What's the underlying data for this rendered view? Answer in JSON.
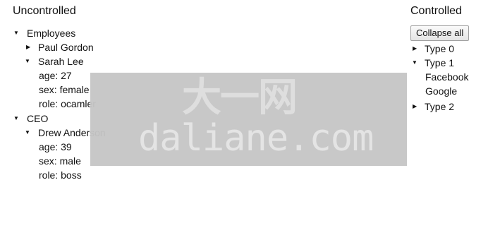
{
  "uncontrolled": {
    "title": "Uncontrolled",
    "employees": {
      "label": "Employees",
      "paul": {
        "name": "Paul Gordon"
      },
      "sarah": {
        "name": "Sarah Lee",
        "age": "age: 27",
        "sex": "sex: female",
        "role": "role: ocamler"
      }
    },
    "ceo": {
      "label": "CEO",
      "drew": {
        "name": "Drew Anderson",
        "age": "age: 39",
        "sex": "sex: male",
        "role": "role: boss"
      }
    }
  },
  "controlled": {
    "title": "Controlled",
    "collapse_all": "Collapse all",
    "types": [
      {
        "label": "Type 0"
      },
      {
        "label": "Type 1",
        "children": [
          "Facebook",
          "Google"
        ]
      },
      {
        "label": "Type 2"
      }
    ]
  },
  "icons": {
    "expanded": "▼",
    "collapsed": "▶"
  },
  "watermark": {
    "chinese": "大一网",
    "domain": "daliane.com"
  }
}
